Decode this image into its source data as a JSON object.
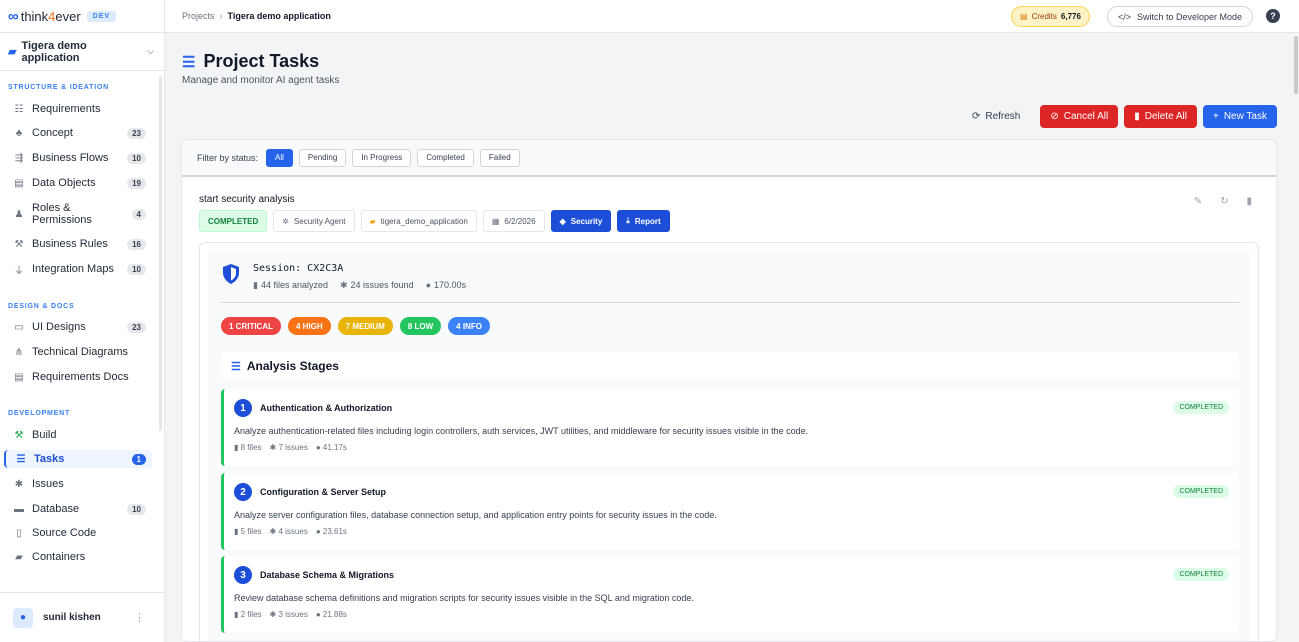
{
  "app": {
    "logo_prefix": "think",
    "logo_four": "4",
    "logo_suffix": "ever",
    "env_badge": "DEV"
  },
  "project": {
    "name": "Tigera demo application"
  },
  "sidebar": {
    "sections": [
      {
        "title": "STRUCTURE & IDEATION"
      },
      {
        "title": "DESIGN & DOCS"
      },
      {
        "title": "DEVELOPMENT"
      }
    ],
    "items": [
      {
        "label": "Requirements",
        "icon": "list-icon",
        "count": ""
      },
      {
        "label": "Concept",
        "icon": "concept-icon",
        "count": "23"
      },
      {
        "label": "Business Flows",
        "icon": "flow-icon",
        "count": "10"
      },
      {
        "label": "Data Objects",
        "icon": "database-icon",
        "count": "19"
      },
      {
        "label": "Roles & Permissions",
        "icon": "roles-icon",
        "count": "4"
      },
      {
        "label": "Business Rules",
        "icon": "gavel-icon",
        "count": "16"
      },
      {
        "label": "Integration Maps",
        "icon": "plug-icon",
        "count": "10"
      },
      {
        "label": "UI Designs",
        "icon": "monitor-icon",
        "count": "23"
      },
      {
        "label": "Technical Diagrams",
        "icon": "diagram-icon",
        "count": ""
      },
      {
        "label": "Requirements Docs",
        "icon": "clipboard-icon",
        "count": ""
      },
      {
        "label": "Build",
        "icon": "hammer-icon",
        "count": ""
      },
      {
        "label": "Tasks",
        "icon": "tasks-icon",
        "count": "1"
      },
      {
        "label": "Issues",
        "icon": "bug-icon",
        "count": ""
      },
      {
        "label": "Database",
        "icon": "server-icon",
        "count": "10"
      },
      {
        "label": "Source Code",
        "icon": "code-file-icon",
        "count": ""
      },
      {
        "label": "Containers",
        "icon": "docker-icon",
        "count": ""
      }
    ],
    "user": "sunil kishen"
  },
  "topbar": {
    "crumb_root": "Projects",
    "crumb_current": "Tigera demo application",
    "credits_label": "Credits",
    "credits_value": "6,776",
    "dev_mode": "Switch to Developer Mode",
    "help": "?"
  },
  "page": {
    "title": "Project Tasks",
    "subtitle": "Manage and monitor AI agent tasks",
    "refresh": "Refresh",
    "cancel_all": "Cancel All",
    "delete_all": "Delete All",
    "new_task": "New Task"
  },
  "filter": {
    "label": "Filter by status:",
    "options": [
      "All",
      "Pending",
      "In Progress",
      "Completed",
      "Failed"
    ],
    "selected": "All"
  },
  "task": {
    "title": "start security analysis",
    "status": "COMPLETED",
    "agent": "Security Agent",
    "folder": "tigera_demo_application",
    "date": "6/2/2026",
    "security_btn": "Security",
    "report_btn": "Report"
  },
  "session": {
    "id": "Session: CX2C3A",
    "files": "44 files analyzed",
    "issues": "24 issues found",
    "duration": "170.00s",
    "severity": [
      {
        "label": "1 CRITICAL",
        "color": "#ef4444"
      },
      {
        "label": "4 HIGH",
        "color": "#f97316"
      },
      {
        "label": "7 MEDIUM",
        "color": "#eab308"
      },
      {
        "label": "8 LOW",
        "color": "#22c55e"
      },
      {
        "label": "4 INFO",
        "color": "#3b82f6"
      }
    ],
    "stages_title": "Analysis Stages",
    "stages": [
      {
        "num": "1",
        "name": "Authentication & Authorization",
        "status": "COMPLETED",
        "desc": "Analyze authentication-related files including login controllers, auth services, JWT utilities, and middleware for security issues visible in the code.",
        "files": "8 files",
        "issues": "7 issues",
        "time": "41.17s"
      },
      {
        "num": "2",
        "name": "Configuration & Server Setup",
        "status": "COMPLETED",
        "desc": "Analyze server configuration files, database connection setup, and application entry points for security issues in the code.",
        "files": "5 files",
        "issues": "4 issues",
        "time": "23.61s"
      },
      {
        "num": "3",
        "name": "Database Schema & Migrations",
        "status": "COMPLETED",
        "desc": "Review database schema definitions and migration scripts for security issues visible in the SQL and migration code.",
        "files": "2 files",
        "issues": "3 issues",
        "time": "21.88s"
      }
    ]
  }
}
